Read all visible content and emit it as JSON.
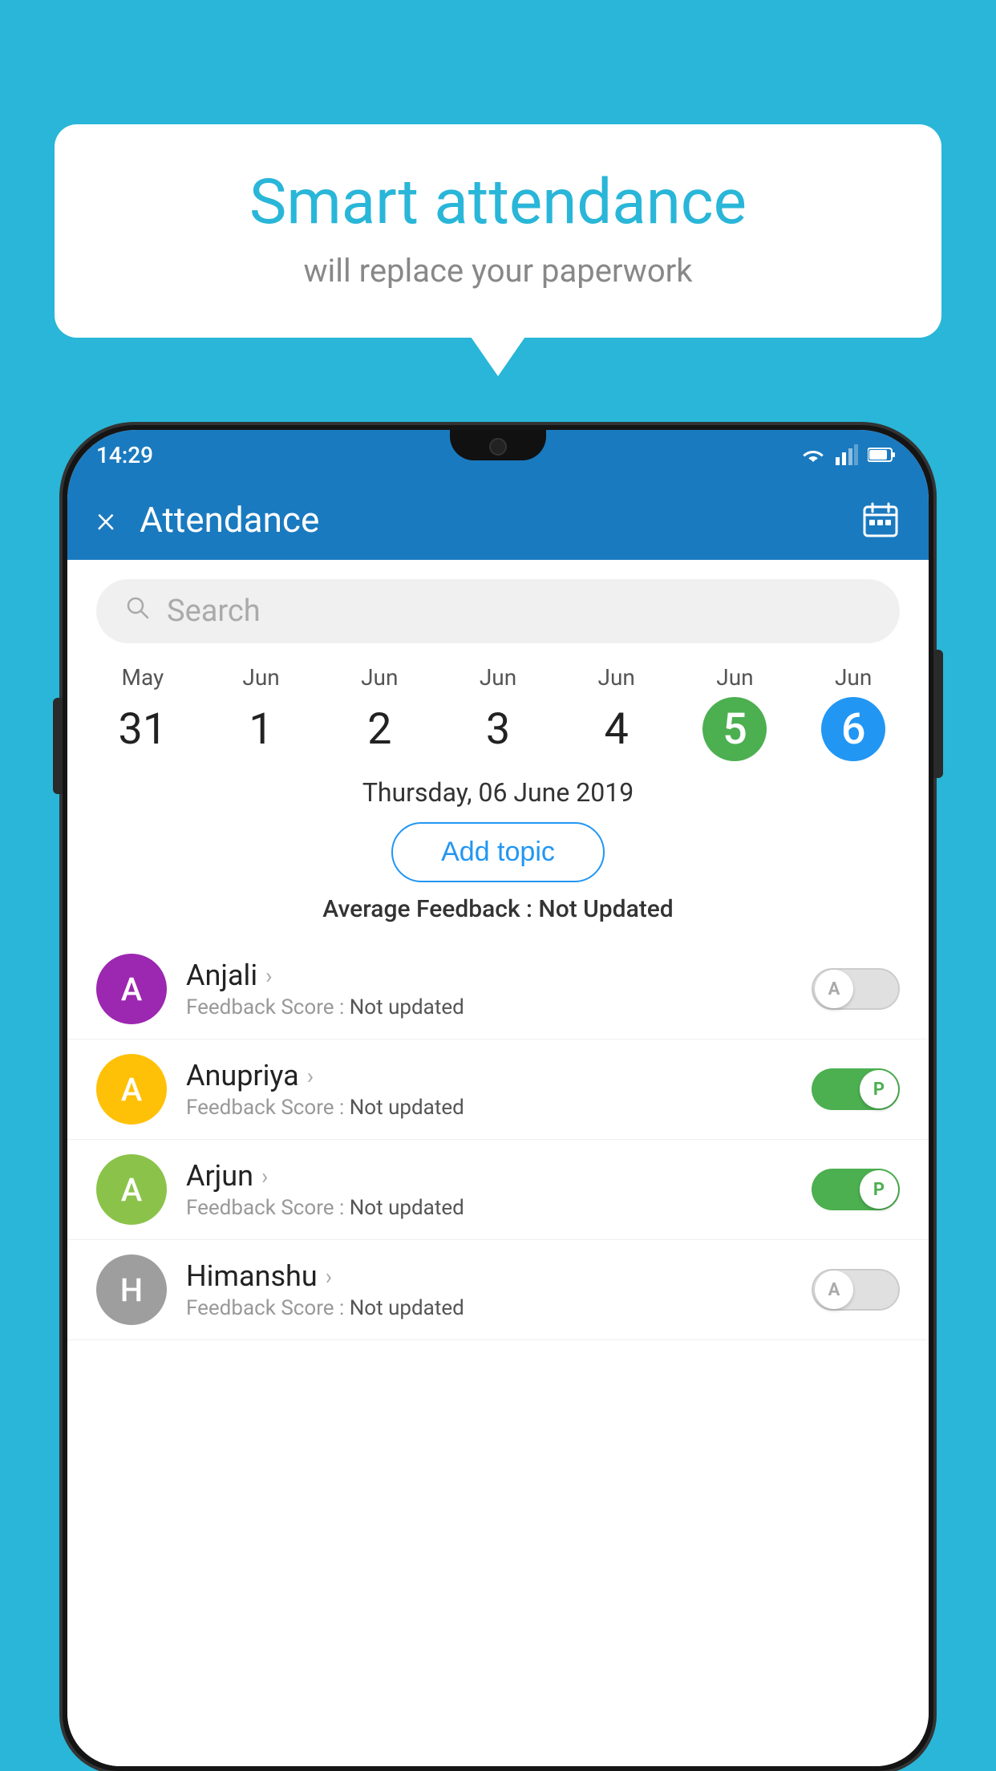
{
  "background_color": "#29b6d8",
  "bubble": {
    "title": "Smart attendance",
    "subtitle": "will replace your paperwork"
  },
  "status_bar": {
    "time": "14:29",
    "wifi_icon": "wifi",
    "signal_icon": "signal",
    "battery_icon": "battery"
  },
  "app_bar": {
    "close_label": "×",
    "title": "Attendance",
    "calendar_icon": "calendar"
  },
  "search": {
    "placeholder": "Search"
  },
  "calendar": {
    "days": [
      {
        "month": "May",
        "day": "31",
        "style": "normal"
      },
      {
        "month": "Jun",
        "day": "1",
        "style": "normal"
      },
      {
        "month": "Jun",
        "day": "2",
        "style": "normal"
      },
      {
        "month": "Jun",
        "day": "3",
        "style": "normal"
      },
      {
        "month": "Jun",
        "day": "4",
        "style": "normal"
      },
      {
        "month": "Jun",
        "day": "5",
        "style": "green"
      },
      {
        "month": "Jun",
        "day": "6",
        "style": "blue"
      }
    ],
    "selected_date": "Thursday, 06 June 2019"
  },
  "add_topic_label": "Add topic",
  "avg_feedback": {
    "label": "Average Feedback : ",
    "value": "Not Updated"
  },
  "students": [
    {
      "name": "Anjali",
      "avatar_letter": "A",
      "avatar_color": "#9c27b0",
      "feedback_label": "Feedback Score : ",
      "feedback_value": "Not updated",
      "toggle": "off",
      "toggle_letter": "A"
    },
    {
      "name": "Anupriya",
      "avatar_letter": "A",
      "avatar_color": "#ffc107",
      "feedback_label": "Feedback Score : ",
      "feedback_value": "Not updated",
      "toggle": "on",
      "toggle_letter": "P"
    },
    {
      "name": "Arjun",
      "avatar_letter": "A",
      "avatar_color": "#8bc34a",
      "feedback_label": "Feedback Score : ",
      "feedback_value": "Not updated",
      "toggle": "on",
      "toggle_letter": "P"
    },
    {
      "name": "Himanshu",
      "avatar_letter": "H",
      "avatar_color": "#9e9e9e",
      "feedback_label": "Feedback Score : ",
      "feedback_value": "Not updated",
      "toggle": "off",
      "toggle_letter": "A"
    }
  ]
}
